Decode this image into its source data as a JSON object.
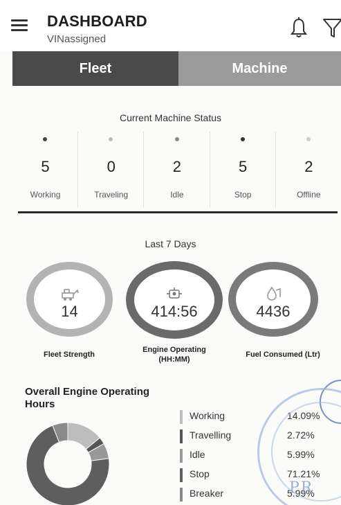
{
  "header": {
    "title": "DASHBOARD",
    "subtitle": "VINassigned",
    "icons": [
      "menu-icon",
      "bell-icon",
      "filter-icon"
    ]
  },
  "tabs": [
    {
      "label": "Fleet",
      "active": true
    },
    {
      "label": "Machine",
      "active": false
    }
  ],
  "status": {
    "title": "Current Machine Status",
    "items": [
      {
        "label": "Working",
        "value": "5",
        "dot_color": "#444444"
      },
      {
        "label": "Traveling",
        "value": "0",
        "dot_color": "#bbbbbb"
      },
      {
        "label": "Idle",
        "value": "2",
        "dot_color": "#888888"
      },
      {
        "label": "Stop",
        "value": "5",
        "dot_color": "#333333"
      },
      {
        "label": "Offline",
        "value": "2",
        "dot_color": "#cccccc"
      }
    ]
  },
  "summary": {
    "title": "Last 7 Days",
    "cards": [
      {
        "value": "14",
        "label": "Fleet Strength",
        "icon": "machine-icon",
        "ring_color": "#b3b3b3"
      },
      {
        "value": "414:56",
        "label": "Engine Operating (HH:MM)",
        "icon": "engine-icon",
        "ring_color": "#6a6a6a"
      },
      {
        "value": "4436",
        "label": "Fuel Consumed (Ltr)",
        "icon": "fuel-icon",
        "ring_color": "#7a7a7a"
      }
    ]
  },
  "overall": {
    "title": "Overall Engine Operating Hours",
    "legend": [
      {
        "name": "Working",
        "pct": "14.09%",
        "color": "#bdbdbd"
      },
      {
        "name": "Travelling",
        "pct": "2.72%",
        "color": "#555555"
      },
      {
        "name": "Idle",
        "pct": "5.99%",
        "color": "#999999"
      },
      {
        "name": "Stop",
        "pct": "71.21%",
        "color": "#5e5e5e"
      },
      {
        "name": "Breaker",
        "pct": "5.99%",
        "color": "#8a8a8a"
      }
    ],
    "donut_values": [
      14.09,
      2.72,
      5.99,
      71.21,
      5.99
    ]
  },
  "stamp_text": "PR"
}
